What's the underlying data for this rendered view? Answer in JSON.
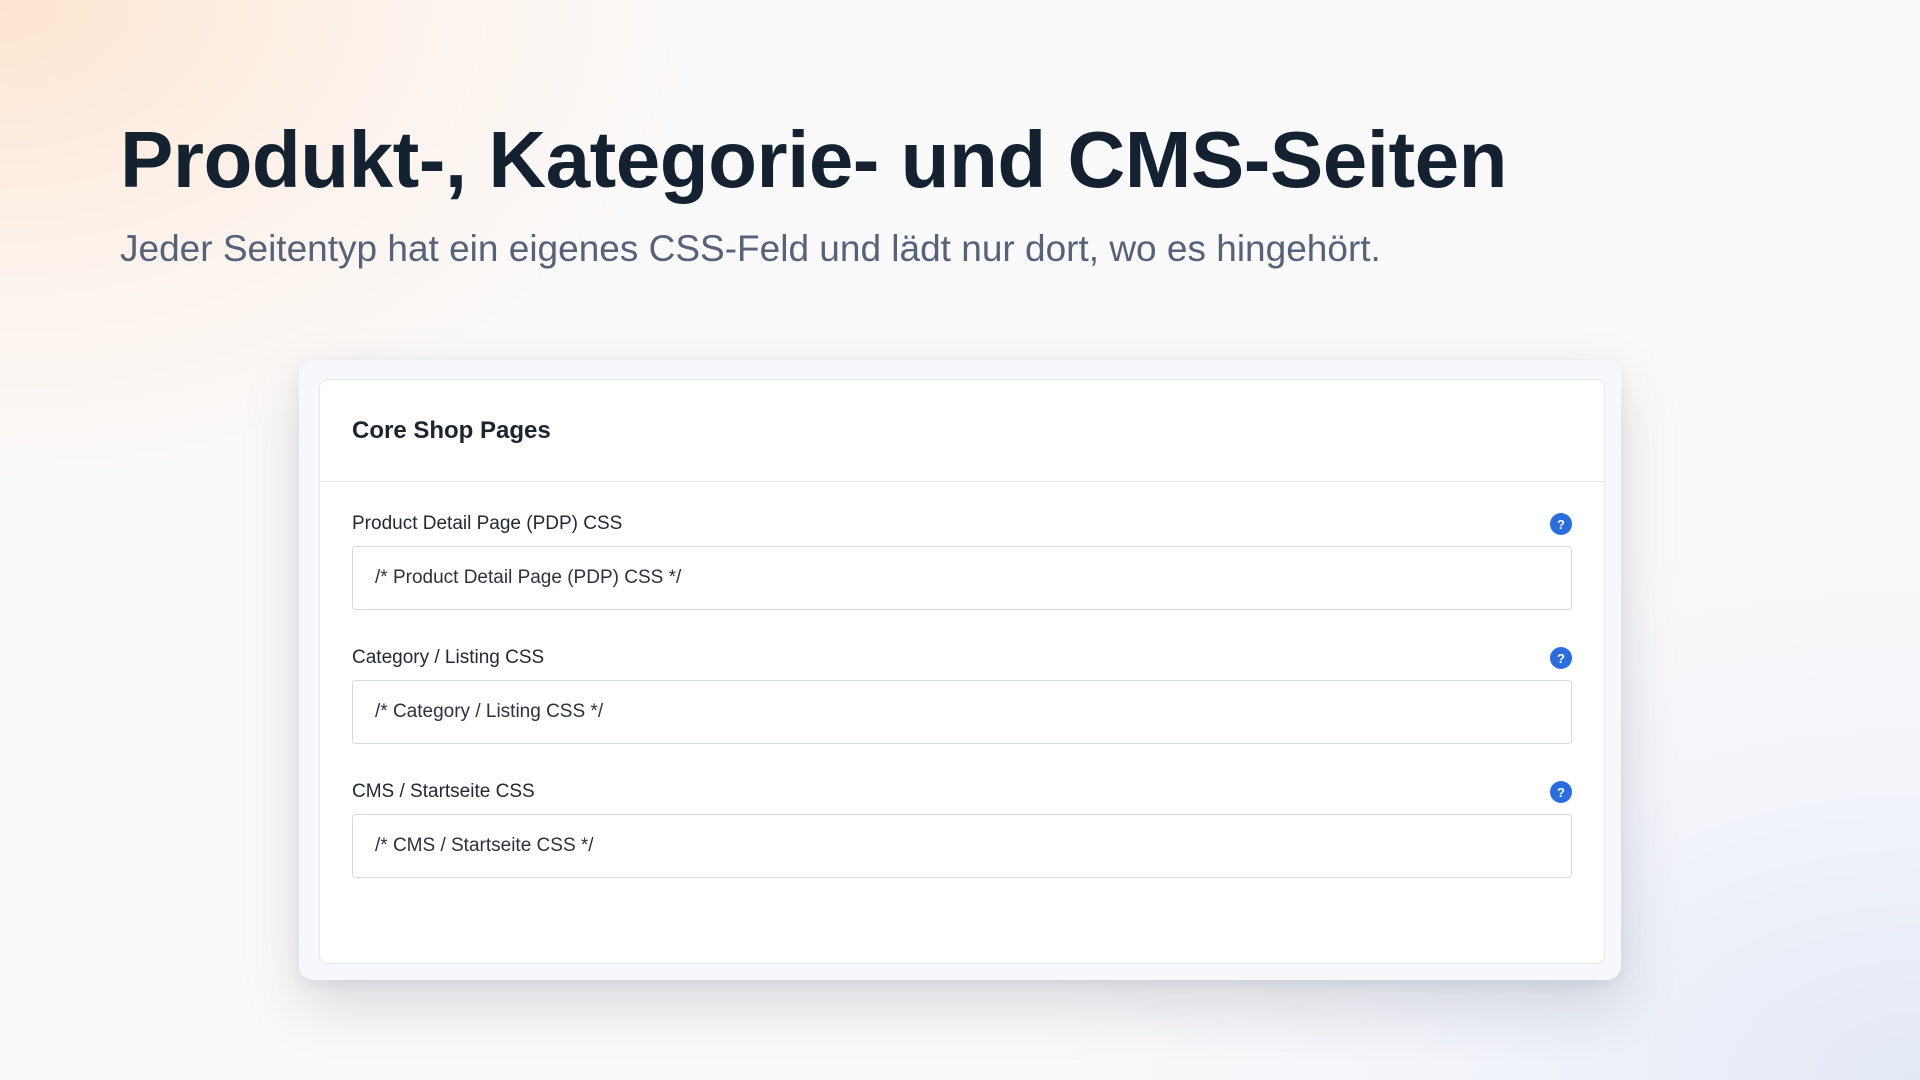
{
  "hero": {
    "headline": "Produkt-, Kategorie- und CMS-Seiten",
    "subtitle": "Jeder Seitentyp hat ein eigenes CSS-Feld und lädt nur dort, wo es hingehört."
  },
  "card": {
    "title": "Core Shop Pages",
    "fields": [
      {
        "label": "Product Detail Page (PDP) CSS",
        "value": "/* Product Detail Page (PDP) CSS */",
        "help": "?"
      },
      {
        "label": "Category / Listing CSS",
        "value": "/* Category / Listing CSS */",
        "help": "?"
      },
      {
        "label": "CMS / Startseite CSS",
        "value": "/* CMS / Startseite CSS */",
        "help": "?"
      }
    ]
  },
  "colors": {
    "accent": "#2a6de0",
    "headline": "#142131",
    "subtitle": "#55627a"
  },
  "icons": {
    "help": "help-circle-icon"
  }
}
